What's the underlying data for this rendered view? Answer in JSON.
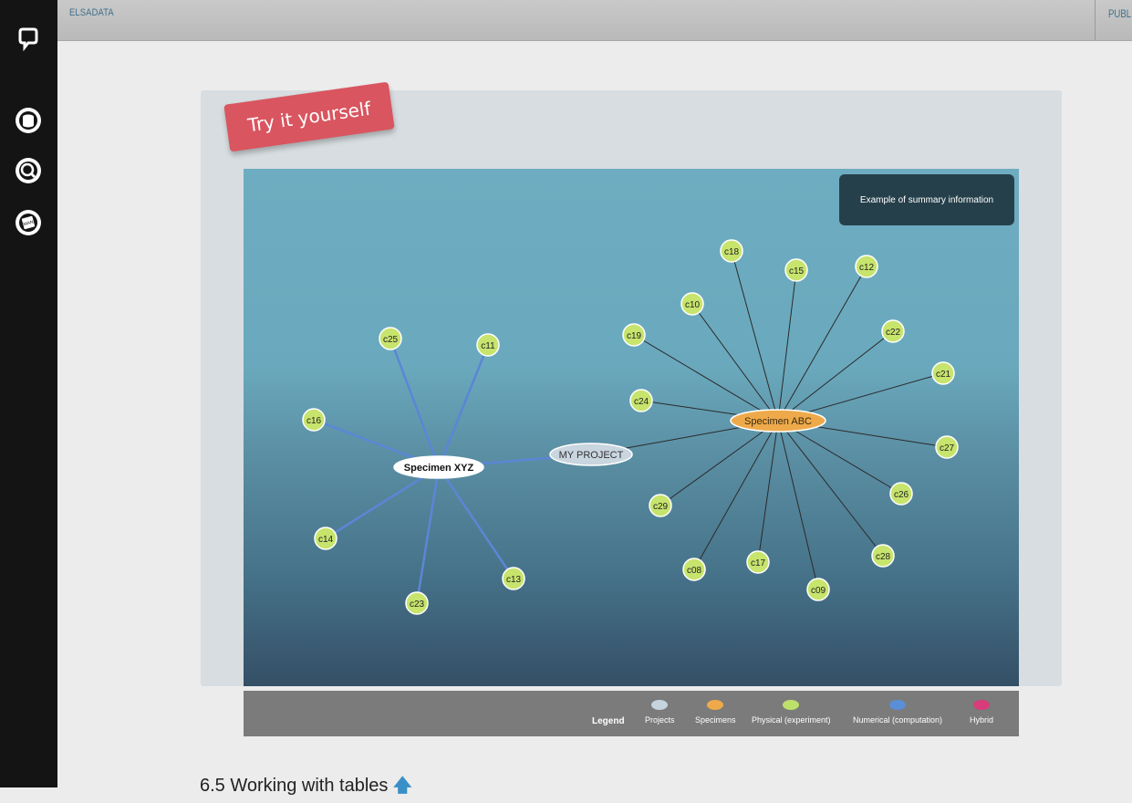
{
  "topbar": {
    "brand": "ELSADATA",
    "right_label": "PUBL"
  },
  "badge": {
    "text": "Try it yourself"
  },
  "summary": {
    "text": "Example of summary information"
  },
  "graph": {
    "project": {
      "label": "MY PROJECT"
    },
    "specimens": [
      {
        "id": "xyz",
        "label": "Specimen XYZ"
      },
      {
        "id": "abc",
        "label": "Specimen ABC"
      }
    ],
    "xyz_children": [
      "c25",
      "c11",
      "c16",
      "c14",
      "c13",
      "c23"
    ],
    "abc_children": [
      "c18",
      "c15",
      "c12",
      "c10",
      "c22",
      "c19",
      "c21",
      "c24",
      "c27",
      "c26",
      "c29",
      "c28",
      "c08",
      "c17",
      "c09"
    ]
  },
  "legend": {
    "title": "Legend",
    "items": [
      {
        "label": "Projects",
        "color": "#c6d4e0"
      },
      {
        "label": "Specimens",
        "color": "#eeaa4a"
      },
      {
        "label": "Physical (experiment)",
        "color": "#bde06a"
      },
      {
        "label": "Numerical (computation)",
        "color": "#5a8fd8"
      },
      {
        "label": "Hybrid",
        "color": "#d83c7a"
      }
    ]
  },
  "section": {
    "heading": "6.5 Working with tables",
    "arrow": "🡅"
  },
  "colors": {
    "leaf": "#c7e46d",
    "specimen_abc": "#eeaa4a",
    "project": "#c9d5df",
    "blue_edge": "#5b86d6",
    "black_edge": "#2a2a2a"
  }
}
